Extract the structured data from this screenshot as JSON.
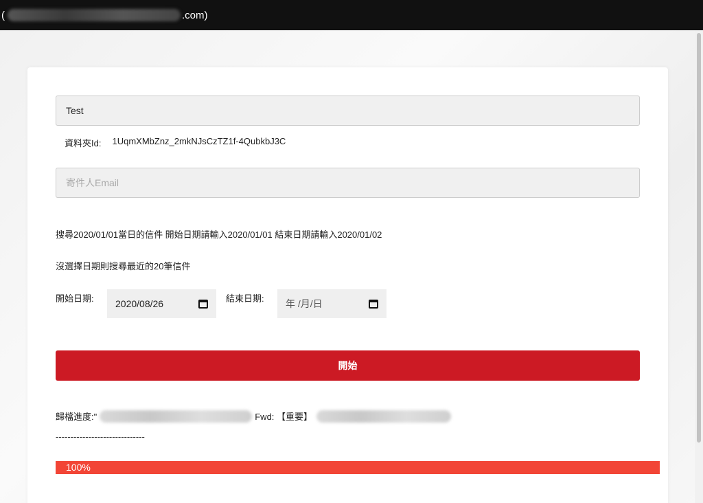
{
  "header": {
    "email_prefix": "(",
    "email_suffix": ".com)"
  },
  "form": {
    "folder_name_value": "Test",
    "folder_id_label": "資料夾Id:",
    "folder_id_value": "1UqmXMbZnz_2mkNJsCzTZ1f-4QubkbJ3C",
    "sender_placeholder": "寄件人Email",
    "hint_line_1": "搜尋2020/01/01當日的信件 開始日期請輸入2020/01/01 結束日期請輸入2020/01/02",
    "hint_line_2": "沒選擇日期則搜尋最近的20筆信件",
    "start_date_label": "開始日期:",
    "start_date_value": "2020/08/26",
    "end_date_label": "結束日期:",
    "end_date_value": "年 /月/日",
    "start_button": "開始"
  },
  "progress": {
    "status_prefix": "歸檔進度:\"",
    "status_middle": "Fwd: 【重要】",
    "divider": "------------------------------",
    "percent_label": "100%",
    "percent": 100,
    "color": "#f24536"
  },
  "colors": {
    "accent": "#cc1a24",
    "topbar": "#111111"
  }
}
